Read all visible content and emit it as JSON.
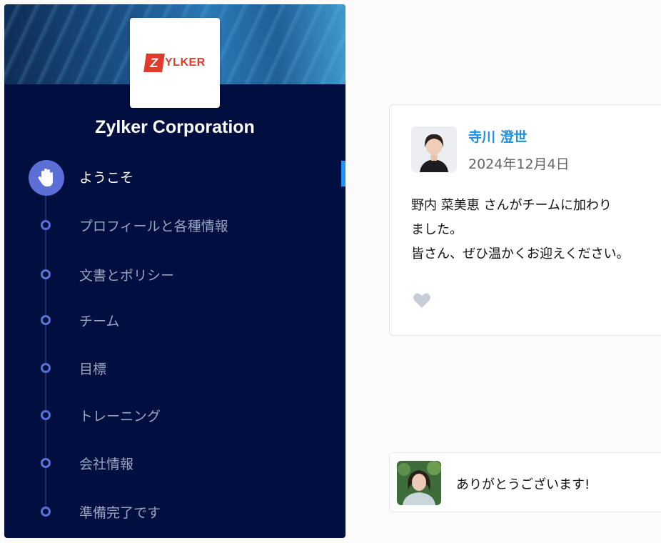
{
  "company": {
    "logo_text": "ZYLKER",
    "name": "Zylker Corporation"
  },
  "steps": [
    {
      "label": "ようこそ",
      "active": true
    },
    {
      "label": "プロフィールと各種情報",
      "active": false
    },
    {
      "label": "文書とポリシー",
      "active": false
    },
    {
      "label": "チーム",
      "active": false
    },
    {
      "label": "目標",
      "active": false
    },
    {
      "label": "トレーニング",
      "active": false
    },
    {
      "label": "会社情報",
      "active": false
    },
    {
      "label": "準備完了です",
      "active": false
    }
  ],
  "post": {
    "author": "寺川 澄世",
    "date": "2024年12月4日",
    "body_lines": [
      "野内 菜美恵 さんがチームに加わり",
      "ました。",
      "皆さん、ぜひ温かくお迎えください。"
    ],
    "like_icon": "heart-icon"
  },
  "comment": {
    "text": "ありがとうございます!"
  },
  "colors": {
    "sidebar_bg": "#000f3f",
    "accent": "#1e90ff",
    "step_dot": "#5a72d8",
    "author_link": "#1f8fe0",
    "brand_red": "#e23b2e"
  }
}
